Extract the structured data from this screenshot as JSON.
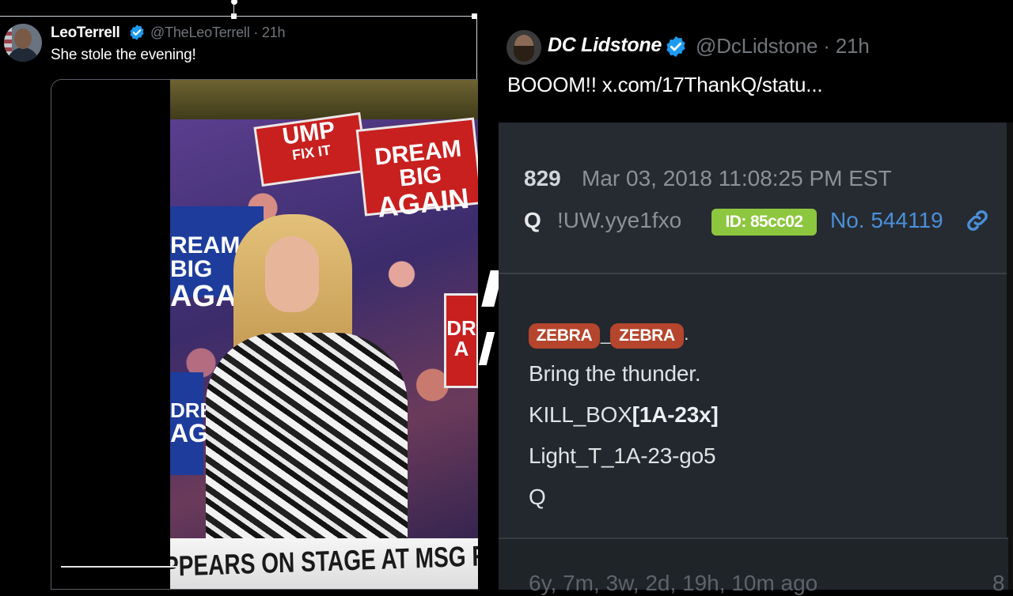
{
  "left_tweet": {
    "author_name": "LeoTerrell",
    "handle_time": "@TheLeoTerrell · 21h",
    "text": "She stole the evening!",
    "video": {
      "signs": [
        "UMP",
        "FIX IT",
        "DREAM BIG",
        "AGAIN",
        "REAM BIG",
        "AGAIN",
        "DR",
        "A",
        "DRE",
        "AG"
      ],
      "chyron": "PPEARS ON STAGE AT MSG RALLY"
    }
  },
  "right_tweet": {
    "author_name": "DC Lidstone",
    "handle_time": "@DcLidstone · 21h",
    "text": "BOOOM!!  x.com/17ThankQ/statu...",
    "qpost": {
      "post_number": "829",
      "date": "Mar 03, 2018 11:08:25 PM EST",
      "author": "Q",
      "tripcode": "!UW.yye1fxo",
      "id_badge": "ID: 85cc02",
      "post_no": "No. 544119",
      "tags": [
        "ZEBRA",
        "ZEBRA"
      ],
      "tag_separator": "_",
      "tag_suffix": ".",
      "lines": {
        "line1": "Bring the thunder.",
        "line2_prefix": "KILL_BOX",
        "line2_bold": "[1A-23x]",
        "line3": "Light_T_1A-23-go5",
        "line4": "Q"
      },
      "ago": "6y, 7m, 3w, 2d, 19h, 10m ago",
      "ago_right": "8"
    }
  },
  "colors": {
    "background": "#000000",
    "verified_blue": "#1d9bf0",
    "id_badge_green": "#8dc63f",
    "tag_red": "#b5452c",
    "post_link_blue": "#4a8fd9",
    "qpost_bg": "#23282e"
  },
  "icons": [
    "verified-badge-icon",
    "link-icon"
  ]
}
